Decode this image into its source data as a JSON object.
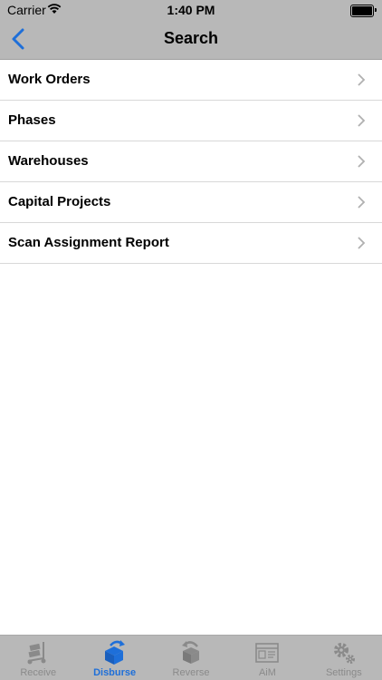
{
  "status_bar": {
    "carrier": "Carrier",
    "time": "1:40 PM"
  },
  "nav": {
    "title": "Search",
    "back_icon": "chevron-left-icon"
  },
  "list": {
    "items": [
      {
        "label": "Work Orders"
      },
      {
        "label": "Phases"
      },
      {
        "label": "Warehouses"
      },
      {
        "label": "Capital Projects"
      },
      {
        "label": "Scan Assignment Report"
      }
    ]
  },
  "tabs": [
    {
      "label": "Receive",
      "icon": "hand-truck-icon",
      "active": false
    },
    {
      "label": "Disburse",
      "icon": "box-arrow-icon",
      "active": true
    },
    {
      "label": "Reverse",
      "icon": "box-return-icon",
      "active": false
    },
    {
      "label": "AiM",
      "icon": "browser-window-icon",
      "active": false
    },
    {
      "label": "Settings",
      "icon": "gears-icon",
      "active": false
    }
  ],
  "colors": {
    "accent": "#1e6fd9",
    "bar": "#b8b8b8",
    "inactive": "#8a8a8a"
  }
}
